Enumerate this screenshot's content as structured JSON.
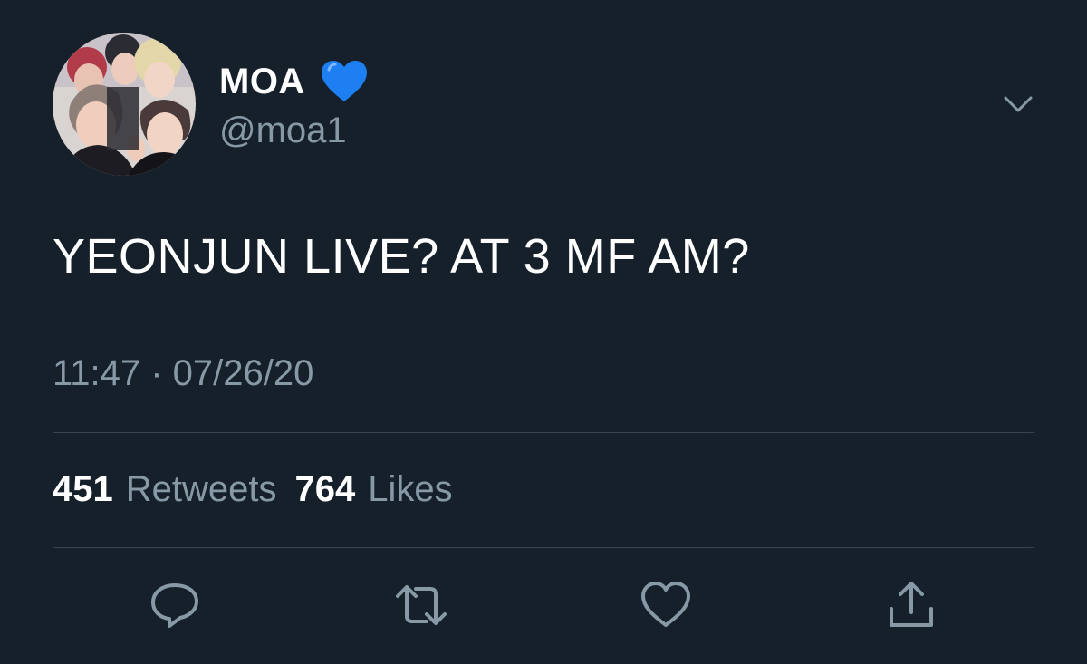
{
  "tweet": {
    "author": {
      "display_name": "MOA",
      "name_emoji": "blue-heart",
      "handle": "@moa1",
      "avatar": "group-photo-avatar"
    },
    "text": "YEONJUN LIVE? AT 3 MF AM?",
    "timestamp": "11:47 · 07/26/20",
    "stats": {
      "retweets_count": "451",
      "retweets_label": "Retweets",
      "likes_count": "764",
      "likes_label": "Likes"
    },
    "actions": {
      "reply_icon": "reply-icon",
      "retweet_icon": "retweet-icon",
      "like_icon": "heart-icon",
      "share_icon": "share-icon"
    },
    "more_icon": "chevron-down-icon"
  },
  "colors": {
    "background": "#15202b",
    "primary_text": "#ffffff",
    "secondary_text": "#8899a6",
    "divider": "#38444d",
    "emoji_heart": "#1d7ff2"
  }
}
